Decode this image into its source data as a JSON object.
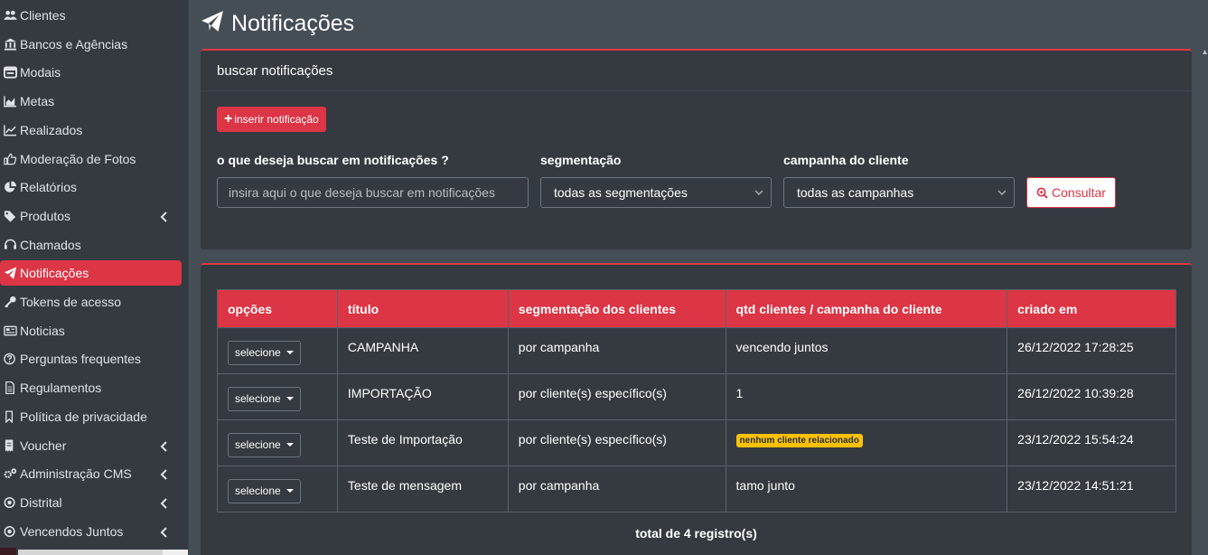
{
  "sidebar": {
    "items": [
      {
        "label": "Clientes",
        "icon": "users-icon",
        "has_children": false,
        "active": false
      },
      {
        "label": "Bancos e Agências",
        "icon": "bank-icon",
        "has_children": false,
        "active": false
      },
      {
        "label": "Modais",
        "icon": "window-icon",
        "has_children": false,
        "active": false
      },
      {
        "label": "Metas",
        "icon": "area-chart-icon",
        "has_children": false,
        "active": false
      },
      {
        "label": "Realizados",
        "icon": "line-chart-icon",
        "has_children": false,
        "active": false
      },
      {
        "label": "Moderação de Fotos",
        "icon": "thumbs-up-icon",
        "has_children": false,
        "active": false
      },
      {
        "label": "Relatórios",
        "icon": "pie-chart-icon",
        "has_children": false,
        "active": false
      },
      {
        "label": "Produtos",
        "icon": "tags-icon",
        "has_children": true,
        "active": false
      },
      {
        "label": "Chamados",
        "icon": "headset-icon",
        "has_children": false,
        "active": false
      },
      {
        "label": "Notificações",
        "icon": "paper-plane-icon",
        "has_children": false,
        "active": true
      },
      {
        "label": "Tokens de acesso",
        "icon": "key-icon",
        "has_children": false,
        "active": false
      },
      {
        "label": "Noticias",
        "icon": "newspaper-icon",
        "has_children": false,
        "active": false
      },
      {
        "label": "Perguntas frequentes",
        "icon": "question-circle-icon",
        "has_children": false,
        "active": false
      },
      {
        "label": "Regulamentos",
        "icon": "file-icon",
        "has_children": false,
        "active": false
      },
      {
        "label": "Política de privacidade",
        "icon": "bookmark-icon",
        "has_children": false,
        "active": false
      },
      {
        "label": "Voucher",
        "icon": "receipt-icon",
        "has_children": true,
        "active": false
      },
      {
        "label": "Administração CMS",
        "icon": "cogs-icon",
        "has_children": true,
        "active": false
      },
      {
        "label": "Distrital",
        "icon": "dot-circle-icon",
        "has_children": true,
        "active": false
      },
      {
        "label": "Vencendos Juntos",
        "icon": "dot-circle-icon",
        "has_children": true,
        "active": false
      }
    ]
  },
  "header": {
    "title": "Notificações",
    "icon": "paper-plane-icon"
  },
  "search_card": {
    "title": "buscar notificações",
    "insert_button": "inserir notificação",
    "query_label": "o que deseja buscar em notificações ?",
    "query_placeholder": "insira aqui o que deseja buscar em notificações",
    "segment_label": "segmentação",
    "segment_value": "todas as segmentações",
    "campaign_label": "campanha do cliente",
    "campaign_value": "todas as campanhas",
    "consult_button": "Consultar"
  },
  "table": {
    "columns": [
      "opções",
      "título",
      "segmentação dos clientes",
      "qtd clientes / campanha do cliente",
      "criado em"
    ],
    "rows": [
      {
        "options": "selecione",
        "title": "CAMPANHA",
        "segment": "por campanha",
        "qty": "vencendo juntos",
        "qty_is_badge": false,
        "created": "26/12/2022 17:28:25"
      },
      {
        "options": "selecione",
        "title": "IMPORTAÇÃO",
        "segment": "por cliente(s) específico(s)",
        "qty": "1",
        "qty_is_badge": false,
        "created": "26/12/2022 10:39:28"
      },
      {
        "options": "selecione",
        "title": "Teste de Importação",
        "segment": "por cliente(s) específico(s)",
        "qty": "nenhum cliente relacionado",
        "qty_is_badge": true,
        "created": "23/12/2022 15:54:24"
      },
      {
        "options": "selecione",
        "title": "Teste de mensagem",
        "segment": "por campanha",
        "qty": "tamo junto",
        "qty_is_badge": false,
        "created": "23/12/2022 14:51:21"
      }
    ],
    "total": "total de 4 registro(s)"
  },
  "colors": {
    "accent": "#dc3545",
    "sidebar_bg": "#343a40",
    "page_bg": "#454d55",
    "badge_warning": "#ffc107"
  }
}
